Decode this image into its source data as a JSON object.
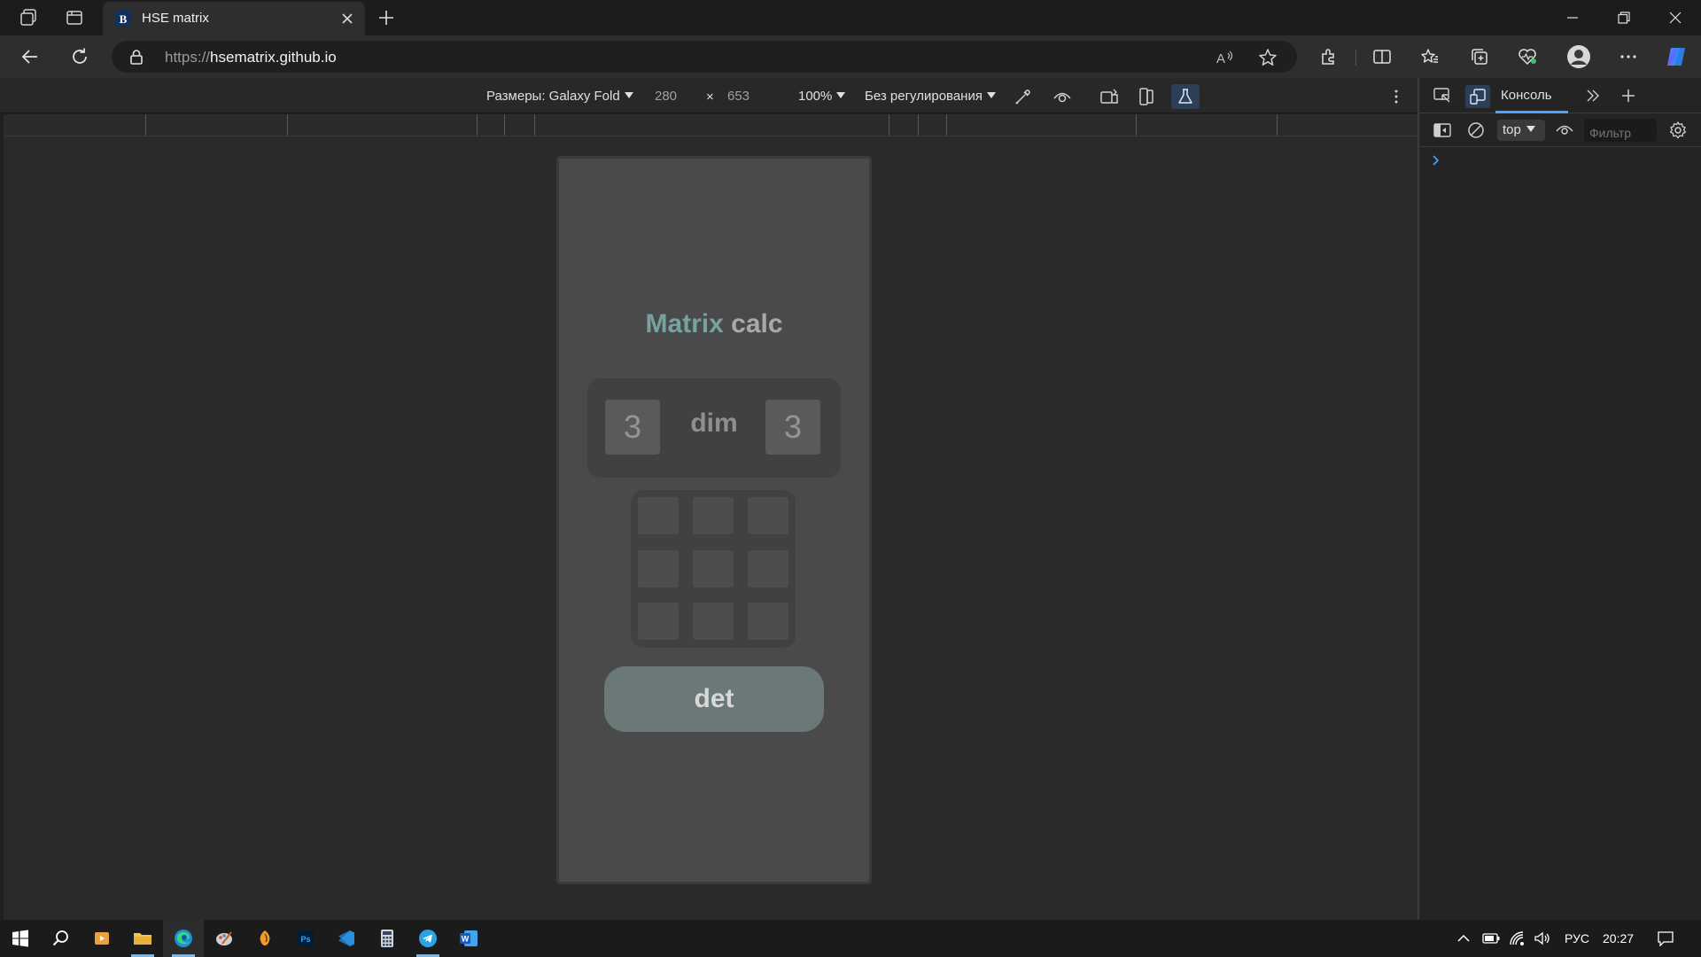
{
  "browser": {
    "tab_title": "HSE matrix",
    "url_scheme": "https://",
    "url_host": "hsematrix.github.io"
  },
  "device_toolbar": {
    "dimensions_label": "Размеры: Galaxy Fold",
    "width": "280",
    "times": "×",
    "height": "653",
    "zoom": "100%",
    "throttling": "Без регулирования"
  },
  "app": {
    "title_accent": "Matrix",
    "title_rest": " calc",
    "rows": "3",
    "dim_label": "dim",
    "cols": "3",
    "det_label": "det"
  },
  "devtools": {
    "console_tab": "Консоль",
    "context": "top",
    "filter_placeholder": "Фильтр"
  },
  "taskbar": {
    "language": "РУС",
    "clock": "20:27"
  },
  "colors": {
    "accent": "#77a39e",
    "det_button": "#6b7878",
    "devtools_tab_underline": "#4aa3ff"
  }
}
